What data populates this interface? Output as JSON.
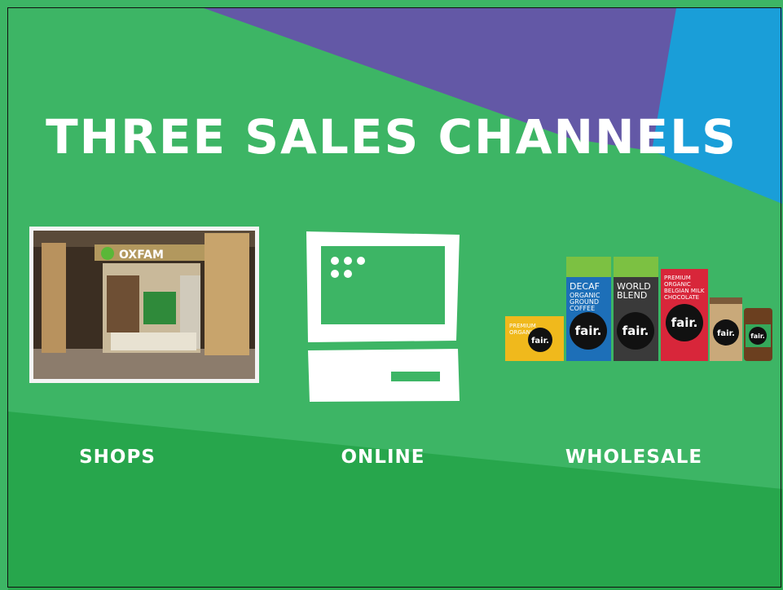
{
  "title": "THREE SALES CHANNELS",
  "channels": [
    {
      "label": "SHOPS"
    },
    {
      "label": "ONLINE"
    },
    {
      "label": "WHOLESALE"
    }
  ],
  "shop_sign": "OXFAM",
  "products": {
    "brand_mark": "fair.",
    "pack_decaf": [
      "DECAF",
      "ORGANIC",
      "GROUND",
      "COFFEE"
    ],
    "pack_world": [
      "WORLD",
      "BLEND"
    ],
    "pack_choc": [
      "PREMIUM",
      "ORGANIC",
      "BELGIAN MILK",
      "CHOCOLATE"
    ],
    "pack_small": [
      "PREMIUM",
      "ORGANIC"
    ]
  },
  "colors": {
    "green": "#3db565",
    "dark_green": "#27a64c",
    "purple": "#6358a6",
    "blue": "#1a9ed8"
  }
}
